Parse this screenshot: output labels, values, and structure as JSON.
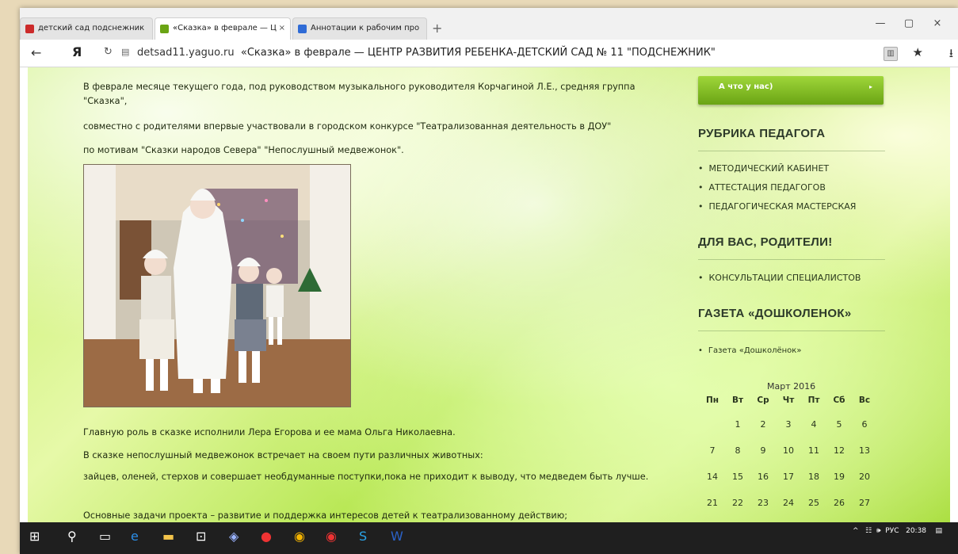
{
  "browser": {
    "tabs": [
      {
        "label": "детский сад подснежник",
        "color": "#cc2b2b"
      },
      {
        "label": "«Сказка» в феврале — Ц",
        "close": "×",
        "color": "#6aa414"
      },
      {
        "label": "Аннотации к рабочим про",
        "color": "#2f6bd6"
      }
    ],
    "new_tab": "+",
    "window_buttons": [
      "—",
      "▢",
      "×"
    ],
    "back": "←",
    "yandex": "Я",
    "reload": "↻",
    "address_domain": "detsad11.yaguo.ru",
    "address_title": "«Сказка» в феврале — ЦЕНТР РАЗВИТИЯ РЕБЕНКА-ДЕТСКИЙ САД № 11 \"ПОДСНЕЖНИК\"",
    "bookmark_icon": "★",
    "download_icon": "⭳"
  },
  "article": {
    "p1": "В феврале месяце текущего года, под руководством музыкального руководителя Корчагиной Л.Е., средняя группа \"Сказка\",",
    "p2": "совместно с родителями впервые участвовали в городском конкурсе \"Театрализованная деятельность в ДОУ\"",
    "p3": "по мотивам \"Сказки народов Севера\" \"Непослушный медвежонок\".",
    "p4": "Главную роль в сказке исполнили Лера Егорова и ее мама Ольга Николаевна.",
    "p5": "В сказке непослушный медвежонок встречает на своем пути различных животных:",
    "p6": "зайцев, оленей, стерхов и совершает необдуманные поступки,пока не приходит к выводу, что медведем быть лучше.",
    "p7": "Основные задачи проекта – развитие и поддержка интересов детей к театрализованному действию;"
  },
  "sidebar": {
    "menu_button": "А что у нас)",
    "menu_arrow": "▸",
    "section1_title": "РУБРИКА ПЕДАГОГА",
    "section1_items": [
      "МЕТОДИЧЕСКИЙ КАБИНЕТ",
      "АТТЕСТАЦИЯ ПЕДАГОГОВ",
      "ПЕДАГОГИЧЕСКАЯ МАСТЕРСКАЯ"
    ],
    "section2_title": "ДЛЯ ВАС, РОДИТЕЛИ!",
    "section2_items": [
      "КОНСУЛЬТАЦИИ СПЕЦИАЛИСТОВ"
    ],
    "section3_title": "ГАЗЕТА «ДОШКОЛЕНОК»",
    "section3_items": [
      "Газета «Дошколёнок»"
    ]
  },
  "calendar": {
    "caption": "Март 2016",
    "days": [
      "Пн",
      "Вт",
      "Ср",
      "Чт",
      "Пт",
      "Сб",
      "Вс"
    ],
    "weeks": [
      [
        "",
        "1",
        "2",
        "3",
        "4",
        "5",
        "6"
      ],
      [
        "7",
        "8",
        "9",
        "10",
        "11",
        "12",
        "13"
      ],
      [
        "14",
        "15",
        "16",
        "17",
        "18",
        "19",
        "20"
      ],
      [
        "21",
        "22",
        "23",
        "24",
        "25",
        "26",
        "27"
      ]
    ]
  },
  "taskbar": {
    "lang": "РУС",
    "time": "20:38"
  }
}
